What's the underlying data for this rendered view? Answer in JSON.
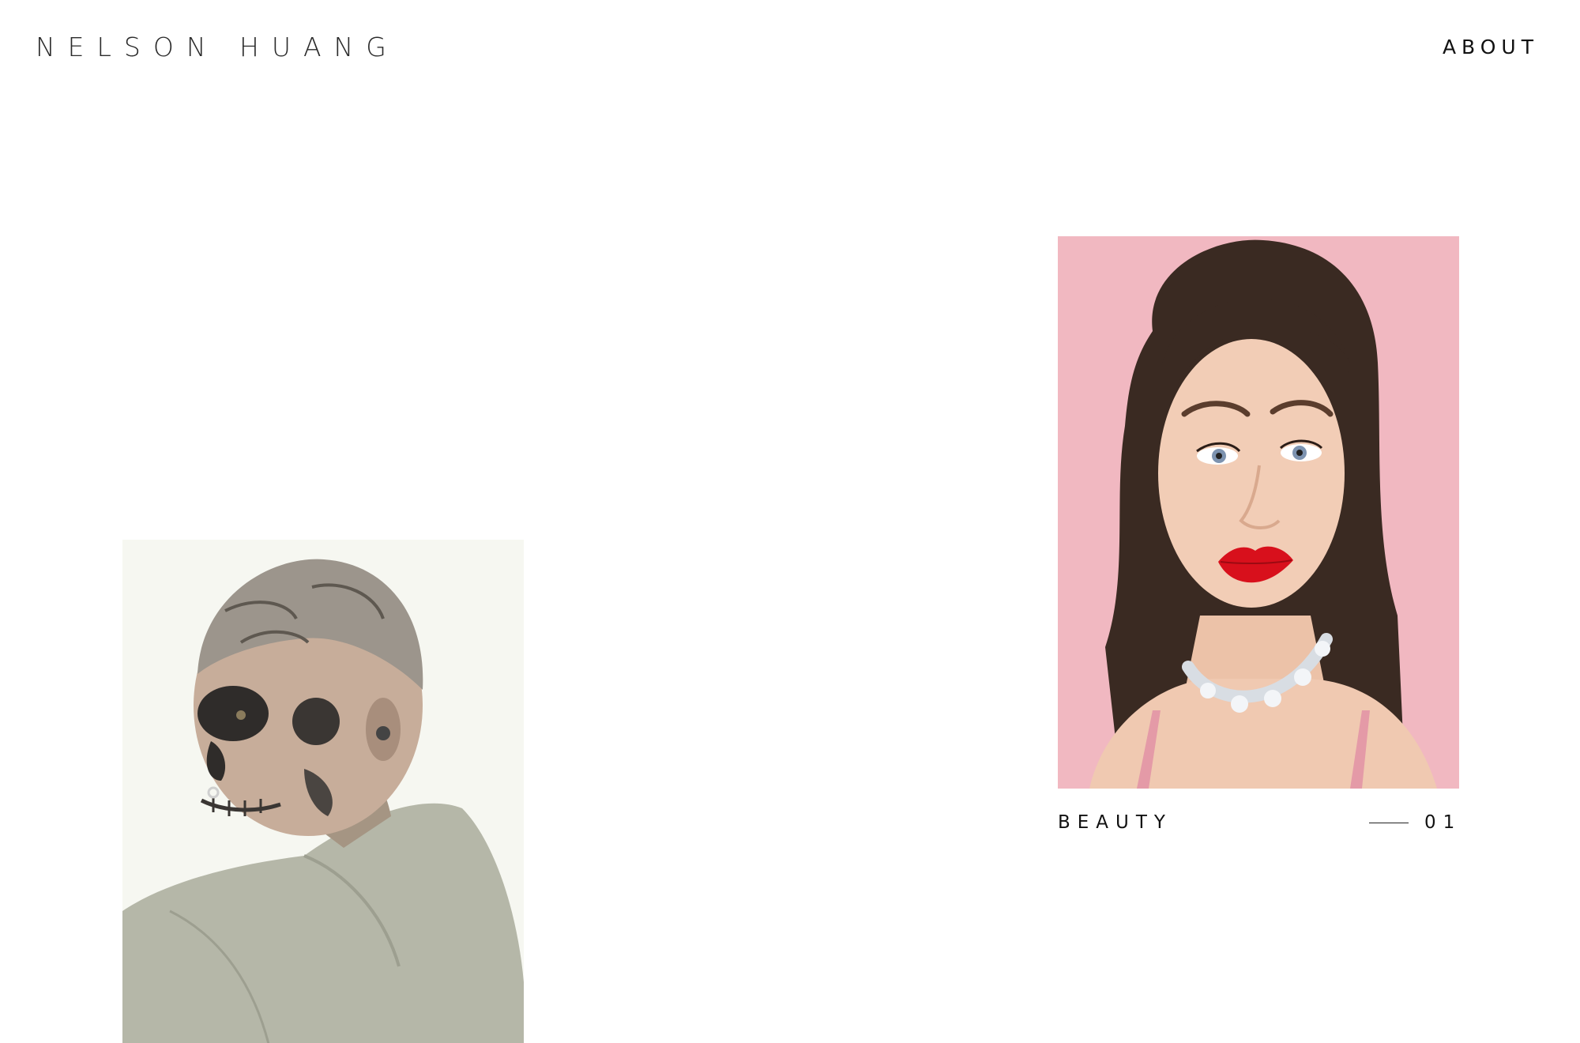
{
  "header": {
    "logo": "NELSON HUANG",
    "nav_about": "ABOUT"
  },
  "projects": [
    {
      "title": "BEAUTY",
      "number": "01",
      "image_alt": "Portrait of woman with red lips and crystal choker on pink background"
    },
    {
      "image_alt": "Portrait of tattooed man looking over shoulder"
    }
  ],
  "colors": {
    "background": "#ffffff",
    "text": "#111111",
    "beauty_backdrop": "#f1b9c2",
    "lip_red": "#d8101c"
  }
}
